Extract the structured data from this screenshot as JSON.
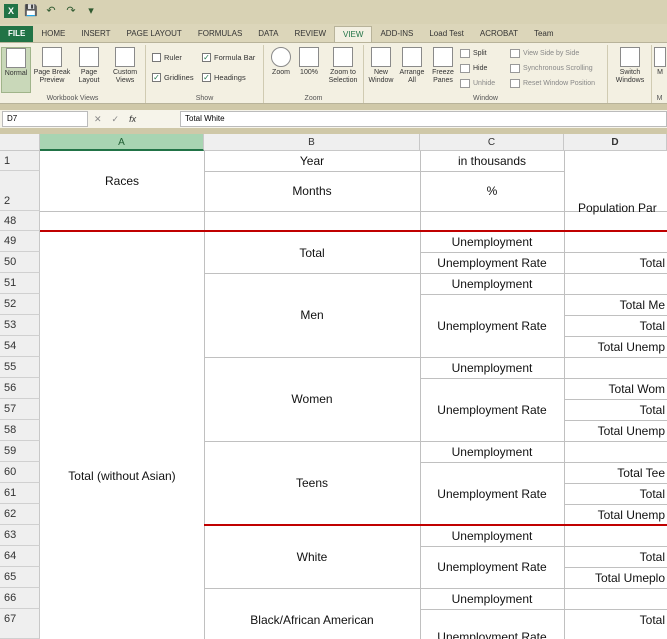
{
  "qat": {
    "save": "💾",
    "undo": "↶",
    "redo": "↷",
    "more": "▾"
  },
  "tabs": [
    "FILE",
    "HOME",
    "INSERT",
    "PAGE LAYOUT",
    "FORMULAS",
    "DATA",
    "REVIEW",
    "VIEW",
    "ADD-INS",
    "Load Test",
    "ACROBAT",
    "Team"
  ],
  "ribbon": {
    "normal": "Normal",
    "page_break": "Page Break Preview",
    "page_layout": "Page Layout",
    "custom_views": "Custom Views",
    "workbook_views": "Workbook Views",
    "ruler": "Ruler",
    "formula_bar": "Formula Bar",
    "gridlines": "Gridlines",
    "headings": "Headings",
    "show": "Show",
    "zoom": "Zoom",
    "zoom100": "100%",
    "zoom_sel": "Zoom to Selection",
    "zoom_group": "Zoom",
    "new_window": "New Window",
    "arrange_all": "Arrange All",
    "freeze": "Freeze Panes",
    "split": "Split",
    "hide": "Hide",
    "unhide": "Unhide",
    "side_by_side": "View Side by Side",
    "sync_scroll": "Synchronous Scrolling",
    "reset_pos": "Reset Window Position",
    "window_group": "Window",
    "switch": "Switch Windows",
    "macros": "M",
    "macros_group": "M"
  },
  "formula_bar": {
    "name_box": "D7",
    "cancel": "✕",
    "enter": "✓",
    "fx": "fx",
    "content": "Total White"
  },
  "columns": [
    "A",
    "B",
    "C",
    "D"
  ],
  "rows": [
    "1",
    "2",
    "48",
    "49",
    "50",
    "51",
    "52",
    "53",
    "54",
    "55",
    "56",
    "57",
    "58",
    "59",
    "60",
    "61",
    "62",
    "63",
    "64",
    "65",
    "66",
    "67"
  ],
  "cells": {
    "races": "Races",
    "year": "Year",
    "months": "Months",
    "in_thousands": "in thousands",
    "percent": "%",
    "population": "Population Par",
    "total_without_asian": "Total (without Asian)",
    "total": "Total",
    "men": "Men",
    "women": "Women",
    "teens": "Teens",
    "white": "White",
    "black": "Black/African American",
    "unemployment": "Unemployment",
    "unemployment_rate": "Unemployment Rate",
    "d50": "Total",
    "d52": "Total Me",
    "d53": "Total",
    "d54": "Total Unemp",
    "d56": "Total Wom",
    "d57": "Total",
    "d58": "Total Unemp",
    "d60": "Total Tee",
    "d61": "Total",
    "d62": "Total Unemp",
    "d64": "Total",
    "d65": "Total Umeplo",
    "d67": "Total"
  }
}
